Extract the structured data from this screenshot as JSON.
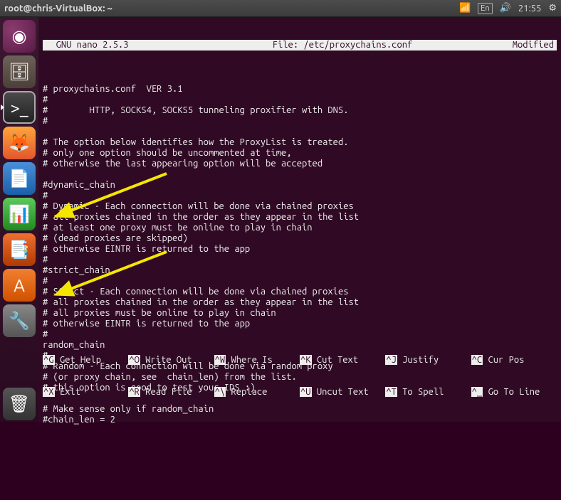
{
  "panel": {
    "window_title": "root@chris-VirtualBox: ~",
    "lang": "En",
    "time": "21:55"
  },
  "launcher": {
    "items": [
      {
        "name": "Dash",
        "icon": "◉"
      },
      {
        "name": "Files",
        "icon": "🗄"
      },
      {
        "name": "Terminal",
        "icon": ">_",
        "active": true
      },
      {
        "name": "Firefox",
        "icon": "🦊"
      },
      {
        "name": "Writer",
        "icon": "📄"
      },
      {
        "name": "Calc",
        "icon": "📊"
      },
      {
        "name": "Impress",
        "icon": "📑"
      },
      {
        "name": "Software",
        "icon": "A"
      },
      {
        "name": "Settings",
        "icon": "🔧"
      }
    ],
    "trash": {
      "name": "Trash",
      "icon": "🗑"
    }
  },
  "nano": {
    "version_label": "  GNU nano 2.5.3",
    "file_label": "File: /etc/proxychains.conf",
    "status": "Modified",
    "lines": [
      "# proxychains.conf  VER 3.1",
      "#",
      "#        HTTP, SOCKS4, SOCKS5 tunneling proxifier with DNS.",
      "#",
      "",
      "# The option below identifies how the ProxyList is treated.",
      "# only one option should be uncommented at time,",
      "# otherwise the last appearing option will be accepted",
      "",
      "#dynamic_chain",
      "#",
      "# Dynamic - Each connection will be done via chained proxies",
      "# all proxies chained in the order as they appear in the list",
      "# at least one proxy must be online to play in chain",
      "# (dead proxies are skipped)",
      "# otherwise EINTR is returned to the app",
      "#",
      "#strict_chain",
      "#",
      "# Strict - Each connection will be done via chained proxies",
      "# all proxies chained in the order as they appear in the list",
      "# all proxies must be online to play in chain",
      "# otherwise EINTR is returned to the app",
      "#",
      "random_chain",
      "#",
      "# Random - Each connection will be done via random proxy",
      "# (or proxy chain, see  chain_len) from the list.",
      "# this option is good to test your IDS :)",
      "",
      "# Make sense only if random_chain",
      "#chain_len = 2"
    ],
    "shortcuts": {
      "row1": [
        {
          "key": "^G",
          "label": "Get Help"
        },
        {
          "key": "^O",
          "label": "Write Out"
        },
        {
          "key": "^W",
          "label": "Where Is"
        },
        {
          "key": "^K",
          "label": "Cut Text"
        },
        {
          "key": "^J",
          "label": "Justify"
        },
        {
          "key": "^C",
          "label": "Cur Pos"
        }
      ],
      "row2": [
        {
          "key": "^X",
          "label": "Exit"
        },
        {
          "key": "^R",
          "label": "Read File"
        },
        {
          "key": "^\\",
          "label": "Replace"
        },
        {
          "key": "^U",
          "label": "Uncut Text"
        },
        {
          "key": "^T",
          "label": "To Spell"
        },
        {
          "key": "^_",
          "label": "Go To Line"
        }
      ]
    }
  }
}
